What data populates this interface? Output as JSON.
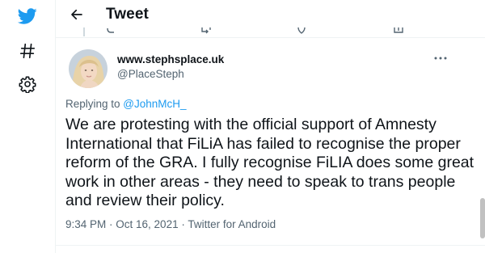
{
  "header": {
    "title": "Tweet"
  },
  "nav": {
    "logo_icon": "twitter-bird-icon",
    "explore_icon": "hashtag-icon",
    "settings_icon": "gear-icon"
  },
  "tweet": {
    "display_name": "www.stephsplace.uk",
    "handle": "@PlaceSteph",
    "replying_prefix": "Replying to ",
    "replying_to": "@JohnMcH_",
    "text": "We are protesting with the official support of Amnesty International that FiLiA has failed to recognise the proper reform of the GRA. I fully recognise FiLIA does some great work in other areas - they need to speak to trans people and review their policy.",
    "time": "9:34 PM",
    "date": "Oct 16, 2021",
    "separator": " · ",
    "source": "Twitter for Android"
  },
  "colors": {
    "brand": "#1d9bf0",
    "text_primary": "#0f1419",
    "text_secondary": "#536471"
  }
}
